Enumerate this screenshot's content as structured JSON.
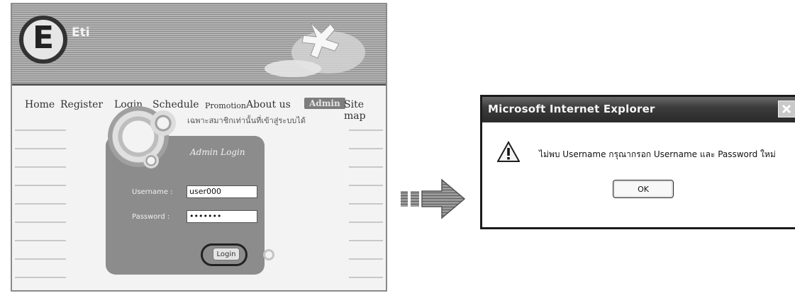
{
  "site": {
    "brand": "Eti",
    "logo_letter": "E",
    "nav": [
      "Home",
      "Register",
      "Login",
      "Schedule",
      "Promotion",
      "About us",
      "Admin",
      "Site map"
    ],
    "login_panel": {
      "note": "เฉพาะสมาชิกเท่านั้นที่เข้าสู่ระบบได้",
      "title": "Admin Login",
      "username_label": "Username :",
      "username_value": "user000",
      "password_label": "Password :",
      "password_value": "•••••••",
      "login_button": "Login"
    }
  },
  "dialog": {
    "title": "Microsoft Internet Explorer",
    "message": "ไม่พบ Username กรุณากรอก Username และ Password ใหม่",
    "ok_label": "OK"
  }
}
